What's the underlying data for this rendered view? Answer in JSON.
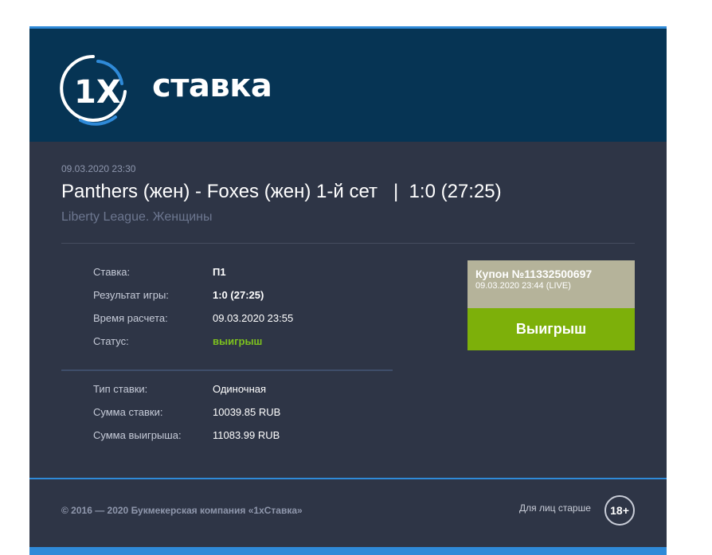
{
  "brand": {
    "logo_mark": "1X",
    "logo_word": "ставка",
    "colors": {
      "header_bg": "#063454",
      "accent_blue": "#2f8ad8",
      "win_green": "#7db00a",
      "coupon_beige": "#b5b39a"
    }
  },
  "event": {
    "datetime": "09.03.2020 23:30",
    "title": "Panthers (жен) - Foxes (жен) 1-й сет   |  1:0 (27:25)",
    "league": "Liberty League. Женщины"
  },
  "bet_details": [
    {
      "label": "Ставка:",
      "value": "П1"
    },
    {
      "label": "Результат игры:",
      "value": "1:0 (27:25)"
    },
    {
      "label": "Время расчета:",
      "value": "09.03.2020 23:55"
    },
    {
      "label": "Статус:",
      "value": "выигрыш"
    }
  ],
  "bet_summary": [
    {
      "label": "Тип ставки:",
      "value": "Одиночная"
    },
    {
      "label": "Сумма ставки:",
      "value": "10039.85 RUB"
    },
    {
      "label": "Сумма выигрыша:",
      "value": "11083.99 RUB"
    }
  ],
  "coupon": {
    "number": "Купон №11332500697",
    "datetime": "09.03.2020 23:44 (LIVE)",
    "result": "Выигрыш"
  },
  "footer": {
    "copyright": "© 2016 — 2020 Букмекерская компания «1xСтавка»",
    "age_text": "Для лиц старше",
    "age_badge": "18+"
  }
}
